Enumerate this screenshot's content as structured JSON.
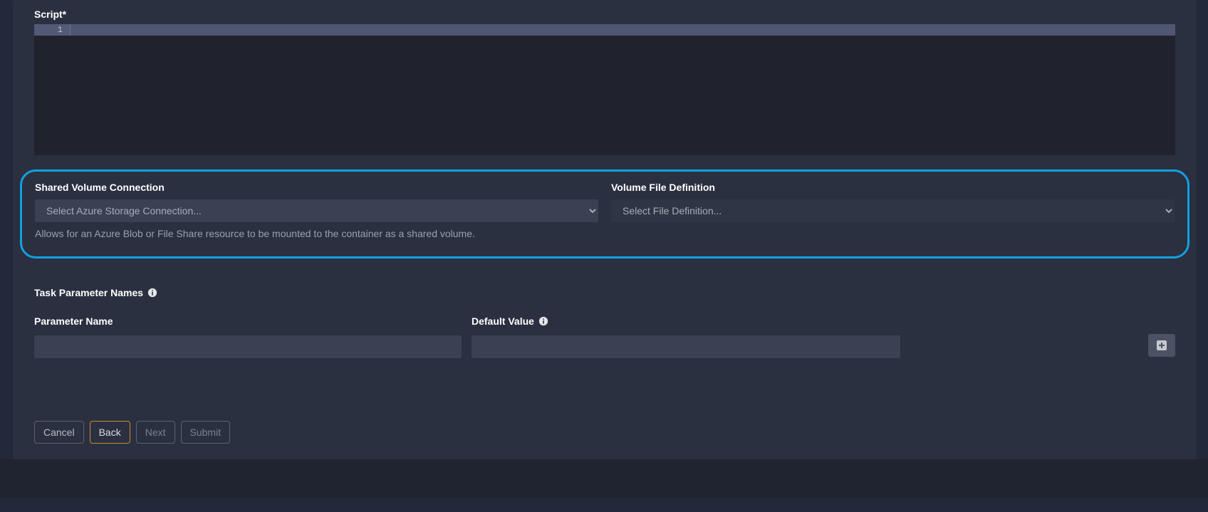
{
  "script": {
    "label": "Script*",
    "line_number": "1"
  },
  "shared_volume": {
    "label": "Shared Volume Connection",
    "placeholder": "Select Azure Storage Connection...",
    "help": "Allows for an Azure Blob or File Share resource to be mounted to the container as a shared volume."
  },
  "volume_file_definition": {
    "label": "Volume File Definition",
    "placeholder": "Select File Definition..."
  },
  "task_params": {
    "label": "Task Parameter Names",
    "columns": {
      "name": "Parameter Name",
      "default_value": "Default Value"
    },
    "rows": [
      {
        "name": "",
        "default_value": ""
      }
    ]
  },
  "wizard": {
    "cancel": "Cancel",
    "back": "Back",
    "next": "Next",
    "submit": "Submit"
  }
}
